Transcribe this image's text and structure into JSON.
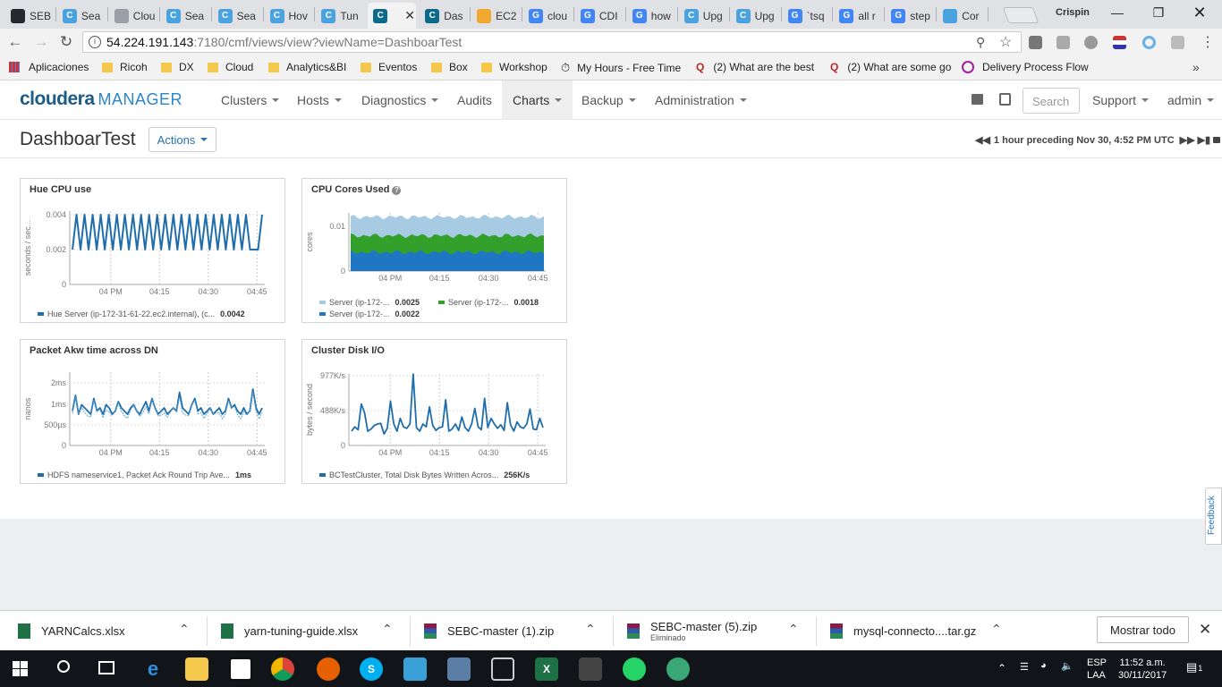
{
  "browser": {
    "tabs": [
      {
        "label": "SEB",
        "icon": "github-icon",
        "color": "#24292e"
      },
      {
        "label": "Sea",
        "icon": "cloudera-icon",
        "color": "#4aa3df"
      },
      {
        "label": "Clou",
        "icon": "document-icon",
        "color": "#9aa0a6"
      },
      {
        "label": "Sea",
        "icon": "cloudera-icon",
        "color": "#4aa3df"
      },
      {
        "label": "Sea",
        "icon": "cloudera-icon",
        "color": "#4aa3df"
      },
      {
        "label": "Hov",
        "icon": "cloudera-icon",
        "color": "#4aa3df"
      },
      {
        "label": "Tun",
        "icon": "cloudera-icon",
        "color": "#4aa3df"
      },
      {
        "label": "",
        "icon": "cloudera-icon",
        "color": "#0b6a8a"
      },
      {
        "label": "Das",
        "icon": "cloudera-icon",
        "color": "#0b6a8a"
      },
      {
        "label": "EC2",
        "icon": "aws-icon",
        "color": "#f0a830"
      },
      {
        "label": "clou",
        "icon": "google-icon",
        "color": "#4285f4"
      },
      {
        "label": "CDI",
        "icon": "google-icon",
        "color": "#4285f4"
      },
      {
        "label": "how",
        "icon": "google-icon",
        "color": "#4285f4"
      },
      {
        "label": "Upg",
        "icon": "cloudera-icon",
        "color": "#4aa3df"
      },
      {
        "label": "Upg",
        "icon": "cloudera-icon",
        "color": "#4aa3df"
      },
      {
        "label": "`tsq",
        "icon": "google-icon",
        "color": "#4285f4"
      },
      {
        "label": "all r",
        "icon": "google-icon",
        "color": "#4285f4"
      },
      {
        "label": "step",
        "icon": "google-icon",
        "color": "#4285f4"
      },
      {
        "label": "Cor",
        "icon": "p-icon",
        "color": "#4aa3df"
      }
    ],
    "profile": "Crispin",
    "url_host": "54.224.191.143",
    "url_rest": ":7180/cmf/views/view?viewName=DashboarTest",
    "bookmarks": [
      {
        "label": "Aplicaciones",
        "icon": "apps-icon"
      },
      {
        "label": "Ricoh",
        "icon": "folder-icon"
      },
      {
        "label": "DX",
        "icon": "folder-icon"
      },
      {
        "label": "Cloud",
        "icon": "folder-icon"
      },
      {
        "label": "Analytics&BI",
        "icon": "folder-icon"
      },
      {
        "label": "Eventos",
        "icon": "folder-icon"
      },
      {
        "label": "Box",
        "icon": "folder-icon"
      },
      {
        "label": "Workshop",
        "icon": "folder-icon"
      },
      {
        "label": "My Hours - Free Time",
        "icon": "stopwatch-icon"
      },
      {
        "label": "(2) What are the best",
        "icon": "quora-icon"
      },
      {
        "label": "(2) What are some go",
        "icon": "quora-icon"
      },
      {
        "label": "Delivery Process Flow",
        "icon": "crown-icon"
      }
    ],
    "more": "»"
  },
  "cm": {
    "logo_main": "cloudera",
    "logo_sub": "MANAGER",
    "nav": [
      "Clusters",
      "Hosts",
      "Diagnostics",
      "Audits",
      "Charts",
      "Backup",
      "Administration"
    ],
    "search_placeholder": "Search",
    "support": "Support",
    "user": "admin",
    "page_title": "DashboarTest",
    "actions": "Actions",
    "time_range": "1 hour preceding Nov 30, 4:52 PM UTC",
    "feedback": "Feedback"
  },
  "chart_data": [
    {
      "type": "line",
      "title": "Hue CPU use",
      "ylabel": "seconds / sec...",
      "y_ticks": [
        "0.004",
        "0.002",
        "0"
      ],
      "x_ticks": [
        "04 PM",
        "04:15",
        "04:30",
        "04:45"
      ],
      "ylim": [
        0,
        0.0045
      ],
      "series": [
        {
          "name": "Hue Server (ip-172-31-61-22.ec2.internal), (c...",
          "value_label": "0.0042",
          "color": "#1f6eab",
          "values": [
            0.002,
            0.004,
            0.002,
            0.004,
            0.002,
            0.004,
            0.002,
            0.004,
            0.002,
            0.004,
            0.002,
            0.004,
            0.002,
            0.004,
            0.002,
            0.004,
            0.002,
            0.004,
            0.002,
            0.004,
            0.002,
            0.004,
            0.002,
            0.004,
            0.002,
            0.004,
            0.002,
            0.004,
            0.002,
            0.004,
            0.002,
            0.004,
            0.002,
            0.004,
            0.002,
            0.004,
            0.002,
            0.004,
            0.002,
            0.004,
            0.002,
            0.004,
            0.002,
            0.004,
            0.002,
            0.002,
            0.002,
            0.004
          ]
        }
      ]
    },
    {
      "type": "area",
      "title": "CPU Cores Used",
      "ylabel": "cores",
      "y_ticks": [
        "0.01",
        "0"
      ],
      "x_ticks": [
        "04 PM",
        "04:15",
        "04:30",
        "04:45"
      ],
      "ylim": [
        0,
        0.013
      ],
      "series": [
        {
          "name": "Server (ip-172-...",
          "value_label": "0.0022",
          "color": "#1f77c4",
          "level": 0.0042
        },
        {
          "name": "Server (ip-172-...",
          "value_label": "0.0018",
          "color": "#33a02c",
          "level": 0.0079
        },
        {
          "name": "Server (ip-172-...",
          "value_label": "0.0025",
          "color": "#a6cbe3",
          "level": 0.0121
        }
      ]
    },
    {
      "type": "line",
      "title": "Packet Akw time across DN",
      "ylabel": "nanos",
      "y_ticks": [
        "2ms",
        "1ms",
        "500µs",
        "0"
      ],
      "x_ticks": [
        "04 PM",
        "04:15",
        "04:30",
        "04:45"
      ],
      "ylim": [
        0,
        2.3
      ],
      "series": [
        {
          "name": "HDFS nameservice1, Packet Ack Round Trip Ave...",
          "value_label": "1ms",
          "color": "#1f6eab",
          "values": [
            1.1,
            1.6,
            1.0,
            1.3,
            1.2,
            1.1,
            1.0,
            1.5,
            1.1,
            1.2,
            1.0,
            1.3,
            1.2,
            1.0,
            1.1,
            1.4,
            1.2,
            1.1,
            1.0,
            1.2,
            1.3,
            1.1,
            1.0,
            1.2,
            1.4,
            1.1,
            1.5,
            1.2,
            1.0,
            1.1,
            1.2,
            1.0,
            1.1,
            1.2,
            1.1,
            1.7,
            1.2,
            1.1,
            1.0,
            1.3,
            1.5,
            1.1,
            1.2,
            1.0,
            1.1,
            1.2,
            1.0,
            1.1,
            1.2,
            1.0,
            1.1,
            1.5,
            1.2,
            1.3,
            1.1,
            1.0,
            1.2,
            1.0,
            1.1,
            1.8,
            1.2,
            1.0,
            1.2
          ]
        }
      ]
    },
    {
      "type": "line",
      "title": "Cluster Disk I/O",
      "ylabel": "bytes / second",
      "y_ticks": [
        "977K/s",
        "488K/s",
        "0"
      ],
      "x_ticks": [
        "04 PM",
        "04:15",
        "04:30",
        "04:45"
      ],
      "ylim": [
        0,
        1000
      ],
      "series": [
        {
          "name": "BCTestCluster, Total Disk Bytes Written Acros...",
          "value_label": "256K/s",
          "color": "#1f6eab",
          "values": [
            200,
            260,
            220,
            580,
            460,
            200,
            230,
            280,
            300,
            310,
            160,
            240,
            620,
            300,
            200,
            380,
            260,
            240,
            300,
            1000,
            250,
            200,
            300,
            260,
            540,
            280,
            210,
            250,
            260,
            640,
            200,
            230,
            300,
            210,
            400,
            250,
            200,
            300,
            520,
            260,
            220,
            660,
            250,
            380,
            300,
            240,
            290,
            210,
            600,
            290,
            200,
            330,
            260,
            240,
            300,
            510,
            230,
            220,
            380,
            250
          ]
        }
      ]
    }
  ],
  "downloads": [
    {
      "name": "YARNCalcs.xlsx",
      "sub": "",
      "icon": "excel-file-icon"
    },
    {
      "name": "yarn-tuning-guide.xlsx",
      "sub": "",
      "icon": "excel-file-icon"
    },
    {
      "name": "SEBC-master (1).zip",
      "sub": "",
      "icon": "archive-icon"
    },
    {
      "name": "SEBC-master (5).zip",
      "sub": "Eliminado",
      "icon": "archive-icon"
    },
    {
      "name": "mysql-connecto....tar.gz",
      "sub": "",
      "icon": "archive-icon"
    }
  ],
  "show_all": "Mostrar todo",
  "taskbar": {
    "lang1": "ESP",
    "lang2": "LAA",
    "time": "11:52 a.m.",
    "date": "30/11/2017",
    "notifications": "1"
  }
}
